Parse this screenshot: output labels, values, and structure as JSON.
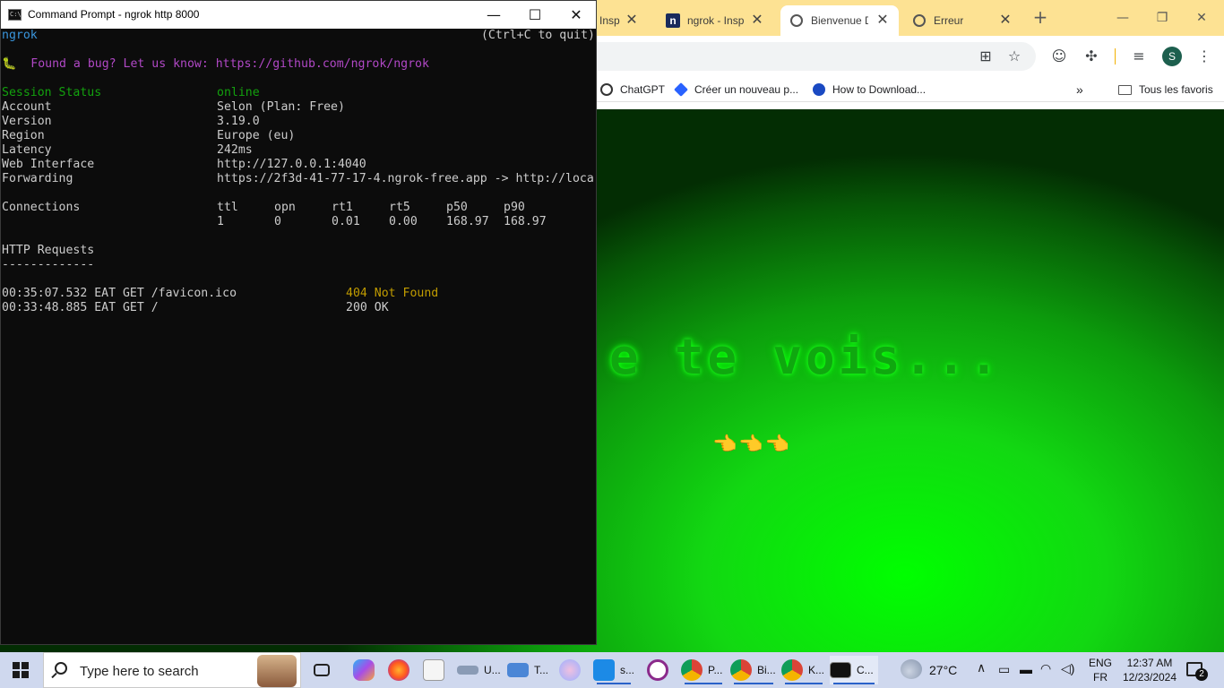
{
  "browser": {
    "tabs": [
      {
        "title": "Insp",
        "favicon": "globe-icon",
        "active": false
      },
      {
        "title": "ngrok - Insp",
        "favicon": "notion-icon",
        "active": false
      },
      {
        "title": "Bienvenue D",
        "favicon": "globe-icon",
        "active": true
      },
      {
        "title": "Erreur",
        "favicon": "globe-icon",
        "active": false
      }
    ],
    "tab_close": "✕",
    "new_tab": "+",
    "bookmarks": [
      {
        "label": "ChatGPT",
        "icon": "chatgpt-icon"
      },
      {
        "label": "Créer un nouveau p...",
        "icon": "bookmark-app-icon"
      },
      {
        "label": "How to Download...",
        "icon": "bookmark-site-icon"
      }
    ],
    "bookmarks_overflow": "»",
    "all_bookmarks": "Tous les favoris",
    "profile_initial": "S",
    "page": {
      "hero_text": "e te vois...",
      "pointers": "👈👈👈"
    }
  },
  "cmd": {
    "title": "Command Prompt - ngrok  http 8000",
    "header_left": "ngrok",
    "header_right": "(Ctrl+C to quit)",
    "bug_line": "🐛  Found a bug? Let us know: https://github.com/ngrok/ngrok",
    "status": [
      {
        "label": "Session Status",
        "value": "online"
      },
      {
        "label": "Account",
        "value": "Selon (Plan: Free)"
      },
      {
        "label": "Version",
        "value": "3.19.0"
      },
      {
        "label": "Region",
        "value": "Europe (eu)"
      },
      {
        "label": "Latency",
        "value": "242ms"
      },
      {
        "label": "Web Interface",
        "value": "http://127.0.0.1:4040"
      },
      {
        "label": "Forwarding",
        "value": "https://2f3d-41-77-17-4.ngrok-free.app -> http://loca"
      }
    ],
    "connections": {
      "label": "Connections",
      "headers": [
        "ttl",
        "opn",
        "rt1",
        "rt5",
        "p50",
        "p90"
      ],
      "values": [
        "1",
        "0",
        "0.01",
        "0.00",
        "168.97",
        "168.97"
      ]
    },
    "http_requests": {
      "label": "HTTP Requests",
      "underline": "-------------",
      "rows": [
        {
          "request": "00:35:07.532 EAT GET /favicon.ico",
          "status": "404 Not Found",
          "color": "#c19c00"
        },
        {
          "request": "00:33:48.885 EAT GET /",
          "status": "200 OK",
          "color": "#cccccc"
        }
      ]
    }
  },
  "taskbar": {
    "search_placeholder": "Type here to search",
    "apps": [
      {
        "label": "U...",
        "icon": "drive-icon"
      },
      {
        "label": "T...",
        "icon": "laptop-icon"
      },
      {
        "label": "P...",
        "icon": "chrome-icon"
      },
      {
        "label": "Bi...",
        "icon": "chrome-icon"
      },
      {
        "label": "K...",
        "icon": "chrome-icon"
      },
      {
        "label": "C...",
        "icon": "cmd-icon"
      }
    ],
    "weather": "27°C",
    "language_top": "ENG",
    "language_bottom": "FR",
    "time": "12:37 AM",
    "date": "12/23/2024",
    "notification_count": "2"
  }
}
